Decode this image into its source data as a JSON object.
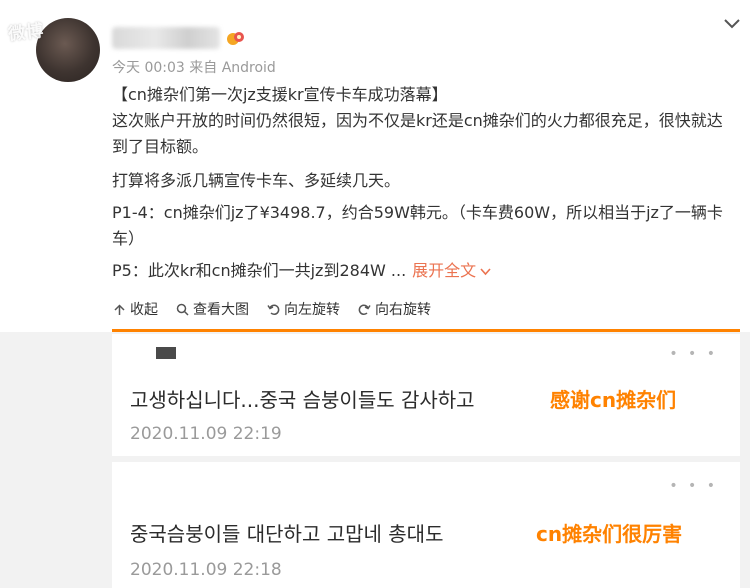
{
  "watermark": "微博",
  "post": {
    "meta": "今天 00:03 来自 Android",
    "lines": [
      "【cn摊杂们第一次jz支援kr宣传卡车成功落幕】",
      "这次账户开放的时间仍然很短，因为不仅是kr还是cn摊杂们的火力都很充足，很快就达到了目标额。",
      "打算将多派几辆宣传卡车、多延续几天。",
      "P1-4：cn摊杂们jz了¥3498.7，约合59W韩元。（卡车费60W，所以相当于jz了一辆卡车）"
    ],
    "last_line": "P5：此次kr和cn摊杂们一共jz到284W ...",
    "expand_label": "展开全文"
  },
  "actions": {
    "collect": "收起",
    "view_large": "查看大图",
    "rotate_left": "向左旋转",
    "rotate_right": "向右旋转"
  },
  "comments": [
    {
      "text": "고생하십니다...중국 슴붕이들도 감사하고",
      "tag": "感谢cn摊杂们",
      "date": "2020.11.09 22:19"
    },
    {
      "text": "중국슴붕이들 대단하고 고맙네 총대도",
      "tag": "cn摊杂们很厉害",
      "date": "2020.11.09 22:18"
    }
  ],
  "colors": {
    "accent": "#ff8200",
    "link": "#eb7350",
    "meta": "#9a9a9a"
  },
  "icons": [
    "chevron-down-icon",
    "badge-icon",
    "collapse-icon",
    "magnifier-icon",
    "rotate-left-icon",
    "rotate-right-icon",
    "more-dots-icon"
  ]
}
